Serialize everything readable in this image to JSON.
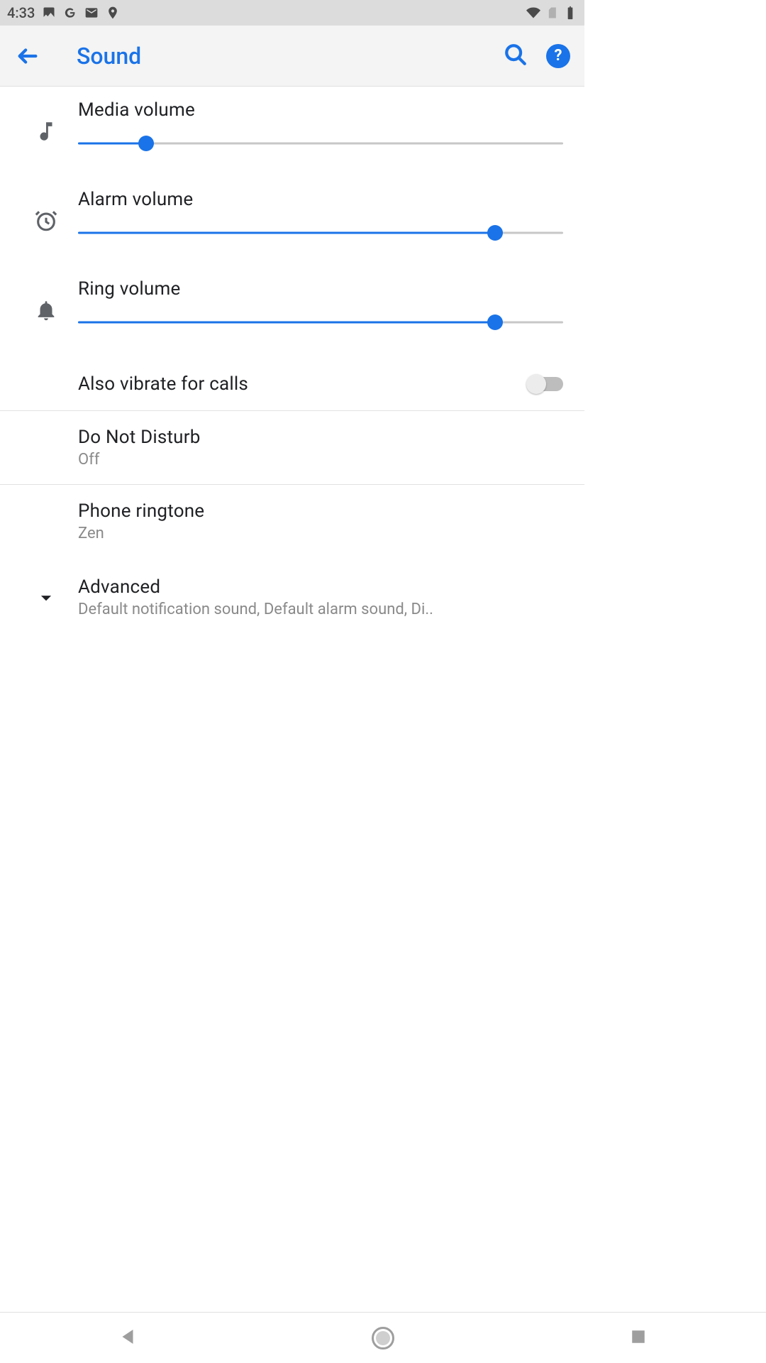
{
  "status": {
    "time": "4:33"
  },
  "appbar": {
    "title": "Sound"
  },
  "sliders": {
    "media": {
      "label": "Media volume",
      "percent": 14
    },
    "alarm": {
      "label": "Alarm volume",
      "percent": 86
    },
    "ring": {
      "label": "Ring volume",
      "percent": 86
    }
  },
  "settings": {
    "vibrate": {
      "label": "Also vibrate for calls",
      "on": false
    },
    "dnd": {
      "label": "Do Not Disturb",
      "value": "Off"
    },
    "ringtone": {
      "label": "Phone ringtone",
      "value": "Zen"
    },
    "advanced": {
      "label": "Advanced",
      "summary": "Default notification sound, Default alarm sound, Di.."
    }
  }
}
